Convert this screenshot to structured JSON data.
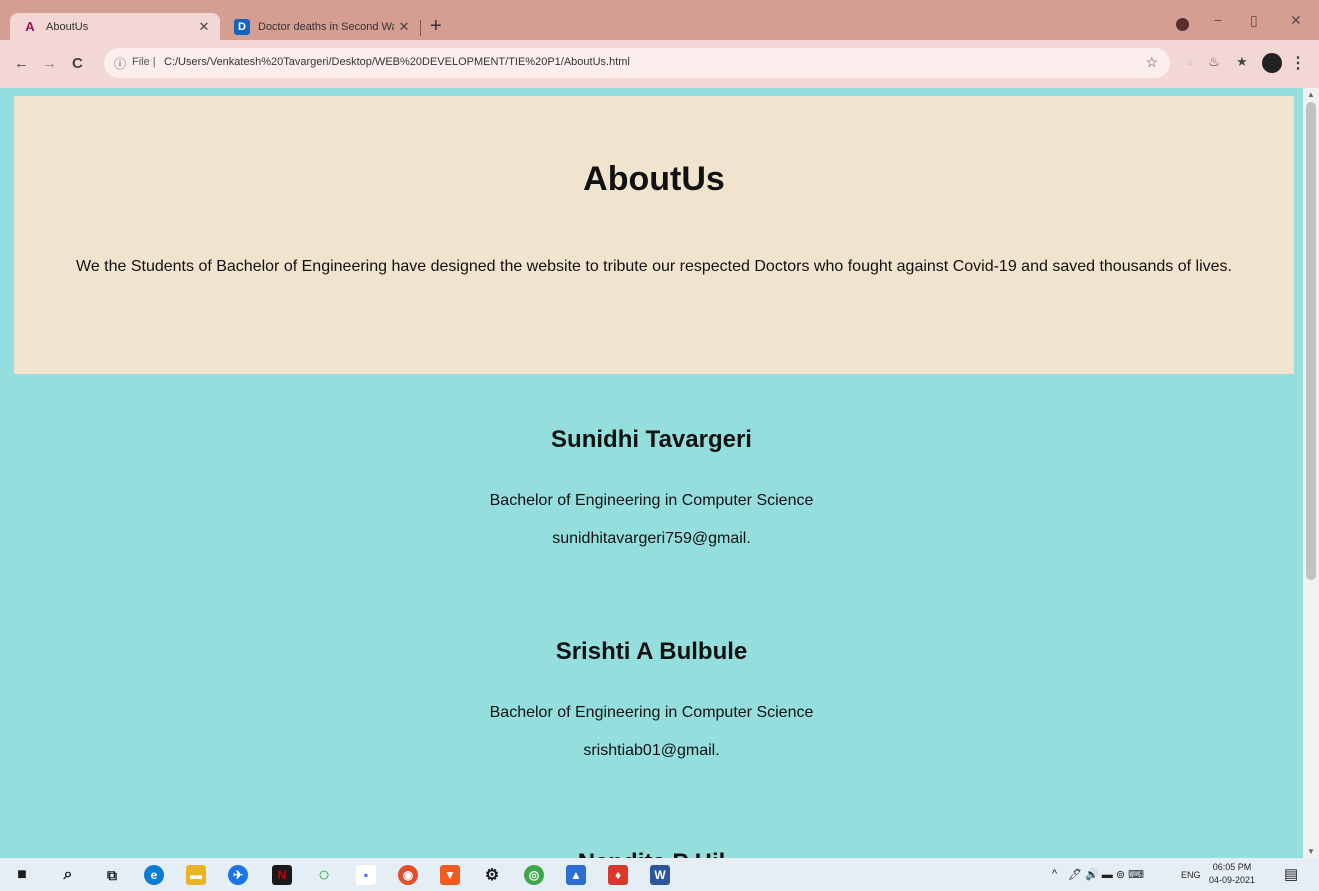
{
  "browser": {
    "tabs": [
      {
        "title": "AboutUs",
        "favicon": "A",
        "favicon_color": "#a0135a"
      },
      {
        "title": "Doctor deaths in Second Wave",
        "favicon": "D",
        "favicon_color": "#1565c0"
      }
    ],
    "new_tab": "+",
    "window": {
      "minimize": "−",
      "restore": "▯",
      "close": "✕"
    },
    "nav": {
      "back": "←",
      "forward": "→",
      "reload": "C"
    },
    "address": {
      "info_icon": "ⓘ",
      "scheme_label": "File |",
      "url": "C:/Users/Venkatesh%20Tavargeri/Desktop/WEB%20DEVELOPMENT/TIE%20P1/AboutUs.html",
      "star": "☆"
    },
    "extensions": [
      "▫",
      "♨",
      "★"
    ],
    "menu": "⋮"
  },
  "page": {
    "hero": {
      "title": "AboutUs",
      "text": "We the Students of Bachelor of Engineering have designed the website to tribute our respected Doctors who fought against Covid-19 and saved thousands of lives."
    },
    "members": [
      {
        "name": "Sunidhi Tavargeri",
        "degree": "Bachelor of Engineering in Computer Science",
        "email": "sunidhitavargeri759@gmail."
      },
      {
        "name": "Srishti A Bulbule",
        "degree": "Bachelor of Engineering in Computer Science",
        "email": "srishtiab01@gmail."
      },
      {
        "name": "Nandita P Hil",
        "degree": "",
        "email": ""
      }
    ]
  },
  "taskbar": {
    "apps": [
      {
        "name": "start",
        "glyph": "■",
        "color": "#1d1d1d"
      },
      {
        "name": "search",
        "glyph": "⌕",
        "color": "#1d1d1d"
      },
      {
        "name": "task-view",
        "glyph": "⧉",
        "color": "#1d1d1d"
      },
      {
        "name": "edge",
        "glyph": "e",
        "color": "#0a7bd6"
      },
      {
        "name": "file-explorer",
        "glyph": "▬",
        "color": "#e8b425"
      },
      {
        "name": "messenger",
        "glyph": "✈",
        "color": "#1a73e8"
      },
      {
        "name": "netflix",
        "glyph": "N",
        "color": "#c00"
      },
      {
        "name": "circle-app",
        "glyph": "○",
        "color": "#2bb34a"
      },
      {
        "name": "notes",
        "glyph": "▪",
        "color": "#3a6fd8"
      },
      {
        "name": "chrome",
        "glyph": "◉",
        "color": "#e24d2a"
      },
      {
        "name": "brave",
        "glyph": "▼",
        "color": "#f25a22"
      },
      {
        "name": "settings",
        "glyph": "⚙",
        "color": "#1d1d1d"
      },
      {
        "name": "xbox",
        "glyph": "◎",
        "color": "#3ca84a"
      },
      {
        "name": "photos",
        "glyph": "▲",
        "color": "#2c6fd1"
      },
      {
        "name": "store",
        "glyph": "♦",
        "color": "#d8392b"
      },
      {
        "name": "word",
        "glyph": "W",
        "color": "#2b579a"
      }
    ],
    "tray": {
      "chevron": "^",
      "icons": "🖊 🔊 ▬ ⊚ ⌨",
      "lang": "ENG"
    },
    "time": "06:05 PM",
    "date": "04-09-2021",
    "notification": "▤"
  }
}
